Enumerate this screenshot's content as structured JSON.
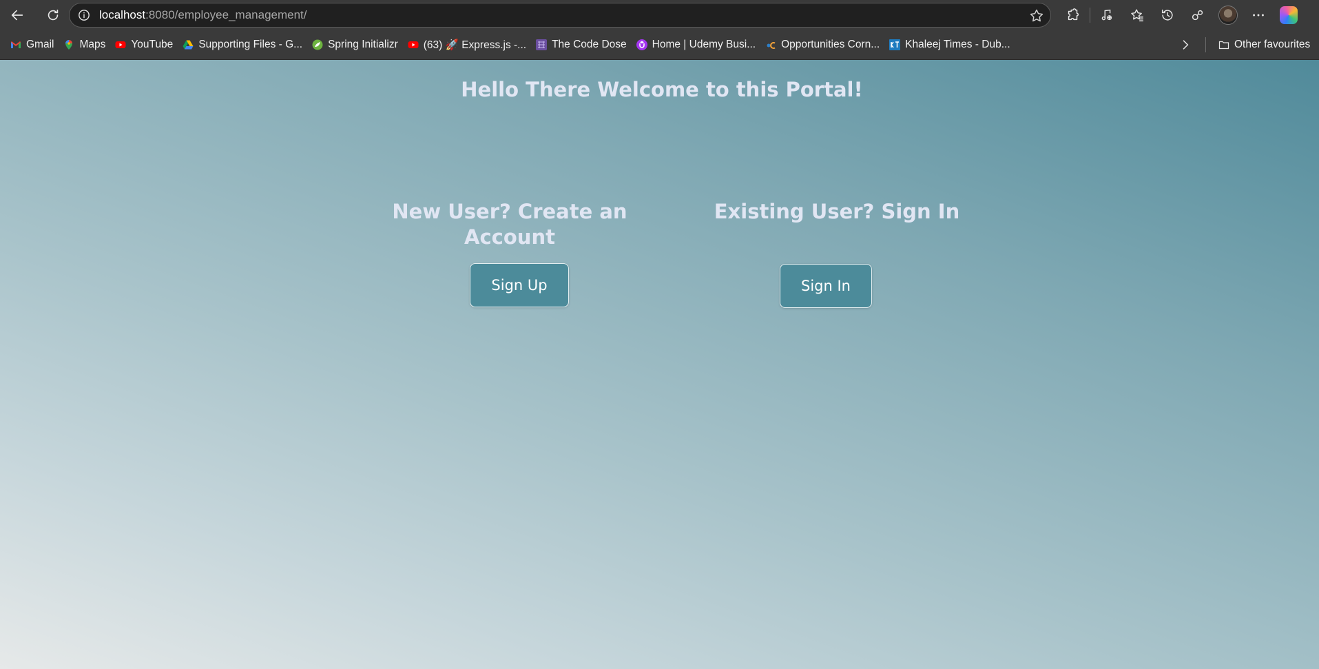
{
  "browser": {
    "url_host": "localhost",
    "url_rest": ":8080/employee_management/",
    "icons": {
      "back": "back-arrow-icon",
      "reload": "reload-icon",
      "info": "info-icon",
      "favorite": "star-icon",
      "extensions": "puzzle-icon",
      "media": "music-note-icon",
      "favorites": "favorites-icon",
      "history": "history-icon",
      "share": "share-icon",
      "more": "ellipsis-icon",
      "copilot": "copilot-icon"
    },
    "bookmarks": [
      {
        "label": "Gmail",
        "icon": "gmail-icon"
      },
      {
        "label": "Maps",
        "icon": "maps-icon"
      },
      {
        "label": "YouTube",
        "icon": "youtube-icon"
      },
      {
        "label": "Supporting Files - G...",
        "icon": "google-drive-icon"
      },
      {
        "label": "Spring Initializr",
        "icon": "spring-icon"
      },
      {
        "label": "(63) 🚀 Express.js -...",
        "icon": "youtube-icon"
      },
      {
        "label": "The Code Dose",
        "icon": "code-dose-icon"
      },
      {
        "label": "Home | Udemy Busi...",
        "icon": "udemy-icon"
      },
      {
        "label": "Opportunities Corn...",
        "icon": "opportunities-icon"
      },
      {
        "label": "Khaleej Times - Dub...",
        "icon": "khaleej-times-icon"
      }
    ],
    "other_favourites": "Other favourites"
  },
  "page": {
    "welcome": "Hello There Welcome to this Portal!",
    "new_user_title": "New User? Create an Account",
    "existing_user_title": "Existing User? Sign In",
    "signup_label": "Sign Up",
    "signin_label": "Sign In"
  },
  "colors": {
    "heading": "#e1e6f3",
    "button_bg": "#4c8b9a",
    "gradient_top_right": "#508a9a",
    "gradient_bottom_left": "#e6e9e9"
  }
}
